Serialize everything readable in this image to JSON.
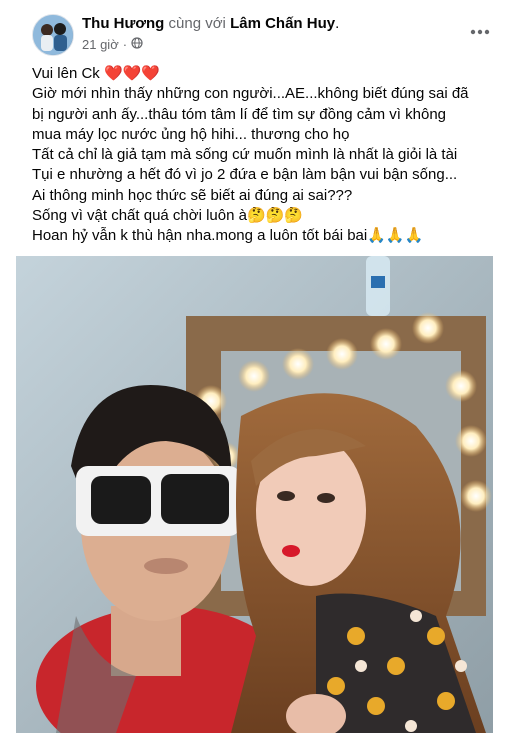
{
  "post": {
    "author": "Thu Hương",
    "with_text": "cùng với",
    "tagged": "Lâm Chấn Huy",
    "time": "21 giờ",
    "privacy_icon": "globe-icon",
    "more_icon": "more-icon",
    "lines": [
      "Vui lên Ck ❤️❤️❤️",
      "Giờ mới nhìn thấy những con người...AE...không biết đúng sai đã",
      "bị người anh ấy...thâu tóm tâm lí để tìm sự đồng cảm vì không",
      "mua máy lọc nước  ủng hộ hihi... thương cho họ",
      "Tất cả chỉ là giả tạm mà sống cứ muốn mình là nhất là giỏi là tài",
      "Tụi e nhường a hết đó vì jo 2 đứa e bận làm bận vui bận sống...",
      "Ai thông minh học thức sẽ biết ai đúng ai sai???",
      "Sống vì vật chất quá chời luôn à🤔🤔🤔",
      "Hoan hỷ vẫn k thù hận nha.mong a luôn tốt bái bai🙏🙏🙏"
    ]
  }
}
